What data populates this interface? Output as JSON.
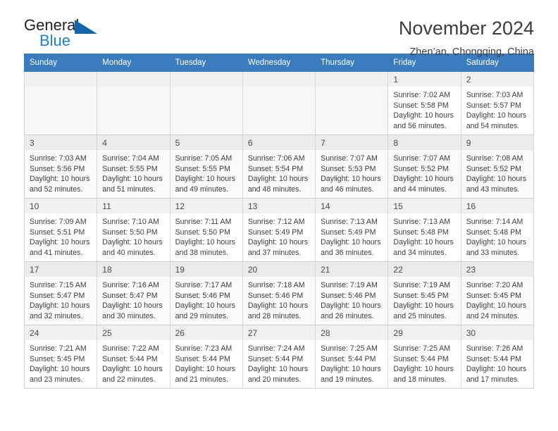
{
  "brand": {
    "name_part1": "General",
    "name_part2": "Blue",
    "triangle_color": "#1565a8",
    "blue_text_color": "#1e7fc2"
  },
  "header": {
    "title": "November 2024",
    "subtitle": "Zhen’an, Chongqing, China"
  },
  "theme": {
    "header_bar_color": "#3a7cbe",
    "header_text_color": "#ffffff",
    "daynum_band_color": "#f0f0f0",
    "alt_row_color": "#fafafa",
    "grid_border_color": "#d7d7d7"
  },
  "weekdays": [
    "Sunday",
    "Monday",
    "Tuesday",
    "Wednesday",
    "Thursday",
    "Friday",
    "Saturday"
  ],
  "weeks": [
    [
      {
        "day": "",
        "empty": true,
        "sunrise": "",
        "sunset": "",
        "daylight1": "",
        "daylight2": ""
      },
      {
        "day": "",
        "empty": true,
        "sunrise": "",
        "sunset": "",
        "daylight1": "",
        "daylight2": ""
      },
      {
        "day": "",
        "empty": true,
        "sunrise": "",
        "sunset": "",
        "daylight1": "",
        "daylight2": ""
      },
      {
        "day": "",
        "empty": true,
        "sunrise": "",
        "sunset": "",
        "daylight1": "",
        "daylight2": ""
      },
      {
        "day": "",
        "empty": true,
        "sunrise": "",
        "sunset": "",
        "daylight1": "",
        "daylight2": ""
      },
      {
        "day": "1",
        "empty": false,
        "sunrise": "Sunrise: 7:02 AM",
        "sunset": "Sunset: 5:58 PM",
        "daylight1": "Daylight: 10 hours",
        "daylight2": "and 56 minutes."
      },
      {
        "day": "2",
        "empty": false,
        "sunrise": "Sunrise: 7:03 AM",
        "sunset": "Sunset: 5:57 PM",
        "daylight1": "Daylight: 10 hours",
        "daylight2": "and 54 minutes."
      }
    ],
    [
      {
        "day": "3",
        "empty": false,
        "sunrise": "Sunrise: 7:03 AM",
        "sunset": "Sunset: 5:56 PM",
        "daylight1": "Daylight: 10 hours",
        "daylight2": "and 52 minutes."
      },
      {
        "day": "4",
        "empty": false,
        "sunrise": "Sunrise: 7:04 AM",
        "sunset": "Sunset: 5:55 PM",
        "daylight1": "Daylight: 10 hours",
        "daylight2": "and 51 minutes."
      },
      {
        "day": "5",
        "empty": false,
        "sunrise": "Sunrise: 7:05 AM",
        "sunset": "Sunset: 5:55 PM",
        "daylight1": "Daylight: 10 hours",
        "daylight2": "and 49 minutes."
      },
      {
        "day": "6",
        "empty": false,
        "sunrise": "Sunrise: 7:06 AM",
        "sunset": "Sunset: 5:54 PM",
        "daylight1": "Daylight: 10 hours",
        "daylight2": "and 48 minutes."
      },
      {
        "day": "7",
        "empty": false,
        "sunrise": "Sunrise: 7:07 AM",
        "sunset": "Sunset: 5:53 PM",
        "daylight1": "Daylight: 10 hours",
        "daylight2": "and 46 minutes."
      },
      {
        "day": "8",
        "empty": false,
        "sunrise": "Sunrise: 7:07 AM",
        "sunset": "Sunset: 5:52 PM",
        "daylight1": "Daylight: 10 hours",
        "daylight2": "and 44 minutes."
      },
      {
        "day": "9",
        "empty": false,
        "sunrise": "Sunrise: 7:08 AM",
        "sunset": "Sunset: 5:52 PM",
        "daylight1": "Daylight: 10 hours",
        "daylight2": "and 43 minutes."
      }
    ],
    [
      {
        "day": "10",
        "empty": false,
        "sunrise": "Sunrise: 7:09 AM",
        "sunset": "Sunset: 5:51 PM",
        "daylight1": "Daylight: 10 hours",
        "daylight2": "and 41 minutes."
      },
      {
        "day": "11",
        "empty": false,
        "sunrise": "Sunrise: 7:10 AM",
        "sunset": "Sunset: 5:50 PM",
        "daylight1": "Daylight: 10 hours",
        "daylight2": "and 40 minutes."
      },
      {
        "day": "12",
        "empty": false,
        "sunrise": "Sunrise: 7:11 AM",
        "sunset": "Sunset: 5:50 PM",
        "daylight1": "Daylight: 10 hours",
        "daylight2": "and 38 minutes."
      },
      {
        "day": "13",
        "empty": false,
        "sunrise": "Sunrise: 7:12 AM",
        "sunset": "Sunset: 5:49 PM",
        "daylight1": "Daylight: 10 hours",
        "daylight2": "and 37 minutes."
      },
      {
        "day": "14",
        "empty": false,
        "sunrise": "Sunrise: 7:13 AM",
        "sunset": "Sunset: 5:49 PM",
        "daylight1": "Daylight: 10 hours",
        "daylight2": "and 36 minutes."
      },
      {
        "day": "15",
        "empty": false,
        "sunrise": "Sunrise: 7:13 AM",
        "sunset": "Sunset: 5:48 PM",
        "daylight1": "Daylight: 10 hours",
        "daylight2": "and 34 minutes."
      },
      {
        "day": "16",
        "empty": false,
        "sunrise": "Sunrise: 7:14 AM",
        "sunset": "Sunset: 5:48 PM",
        "daylight1": "Daylight: 10 hours",
        "daylight2": "and 33 minutes."
      }
    ],
    [
      {
        "day": "17",
        "empty": false,
        "sunrise": "Sunrise: 7:15 AM",
        "sunset": "Sunset: 5:47 PM",
        "daylight1": "Daylight: 10 hours",
        "daylight2": "and 32 minutes."
      },
      {
        "day": "18",
        "empty": false,
        "sunrise": "Sunrise: 7:16 AM",
        "sunset": "Sunset: 5:47 PM",
        "daylight1": "Daylight: 10 hours",
        "daylight2": "and 30 minutes."
      },
      {
        "day": "19",
        "empty": false,
        "sunrise": "Sunrise: 7:17 AM",
        "sunset": "Sunset: 5:46 PM",
        "daylight1": "Daylight: 10 hours",
        "daylight2": "and 29 minutes."
      },
      {
        "day": "20",
        "empty": false,
        "sunrise": "Sunrise: 7:18 AM",
        "sunset": "Sunset: 5:46 PM",
        "daylight1": "Daylight: 10 hours",
        "daylight2": "and 28 minutes."
      },
      {
        "day": "21",
        "empty": false,
        "sunrise": "Sunrise: 7:19 AM",
        "sunset": "Sunset: 5:46 PM",
        "daylight1": "Daylight: 10 hours",
        "daylight2": "and 26 minutes."
      },
      {
        "day": "22",
        "empty": false,
        "sunrise": "Sunrise: 7:19 AM",
        "sunset": "Sunset: 5:45 PM",
        "daylight1": "Daylight: 10 hours",
        "daylight2": "and 25 minutes."
      },
      {
        "day": "23",
        "empty": false,
        "sunrise": "Sunrise: 7:20 AM",
        "sunset": "Sunset: 5:45 PM",
        "daylight1": "Daylight: 10 hours",
        "daylight2": "and 24 minutes."
      }
    ],
    [
      {
        "day": "24",
        "empty": false,
        "sunrise": "Sunrise: 7:21 AM",
        "sunset": "Sunset: 5:45 PM",
        "daylight1": "Daylight: 10 hours",
        "daylight2": "and 23 minutes."
      },
      {
        "day": "25",
        "empty": false,
        "sunrise": "Sunrise: 7:22 AM",
        "sunset": "Sunset: 5:44 PM",
        "daylight1": "Daylight: 10 hours",
        "daylight2": "and 22 minutes."
      },
      {
        "day": "26",
        "empty": false,
        "sunrise": "Sunrise: 7:23 AM",
        "sunset": "Sunset: 5:44 PM",
        "daylight1": "Daylight: 10 hours",
        "daylight2": "and 21 minutes."
      },
      {
        "day": "27",
        "empty": false,
        "sunrise": "Sunrise: 7:24 AM",
        "sunset": "Sunset: 5:44 PM",
        "daylight1": "Daylight: 10 hours",
        "daylight2": "and 20 minutes."
      },
      {
        "day": "28",
        "empty": false,
        "sunrise": "Sunrise: 7:25 AM",
        "sunset": "Sunset: 5:44 PM",
        "daylight1": "Daylight: 10 hours",
        "daylight2": "and 19 minutes."
      },
      {
        "day": "29",
        "empty": false,
        "sunrise": "Sunrise: 7:25 AM",
        "sunset": "Sunset: 5:44 PM",
        "daylight1": "Daylight: 10 hours",
        "daylight2": "and 18 minutes."
      },
      {
        "day": "30",
        "empty": false,
        "sunrise": "Sunrise: 7:26 AM",
        "sunset": "Sunset: 5:44 PM",
        "daylight1": "Daylight: 10 hours",
        "daylight2": "and 17 minutes."
      }
    ]
  ]
}
